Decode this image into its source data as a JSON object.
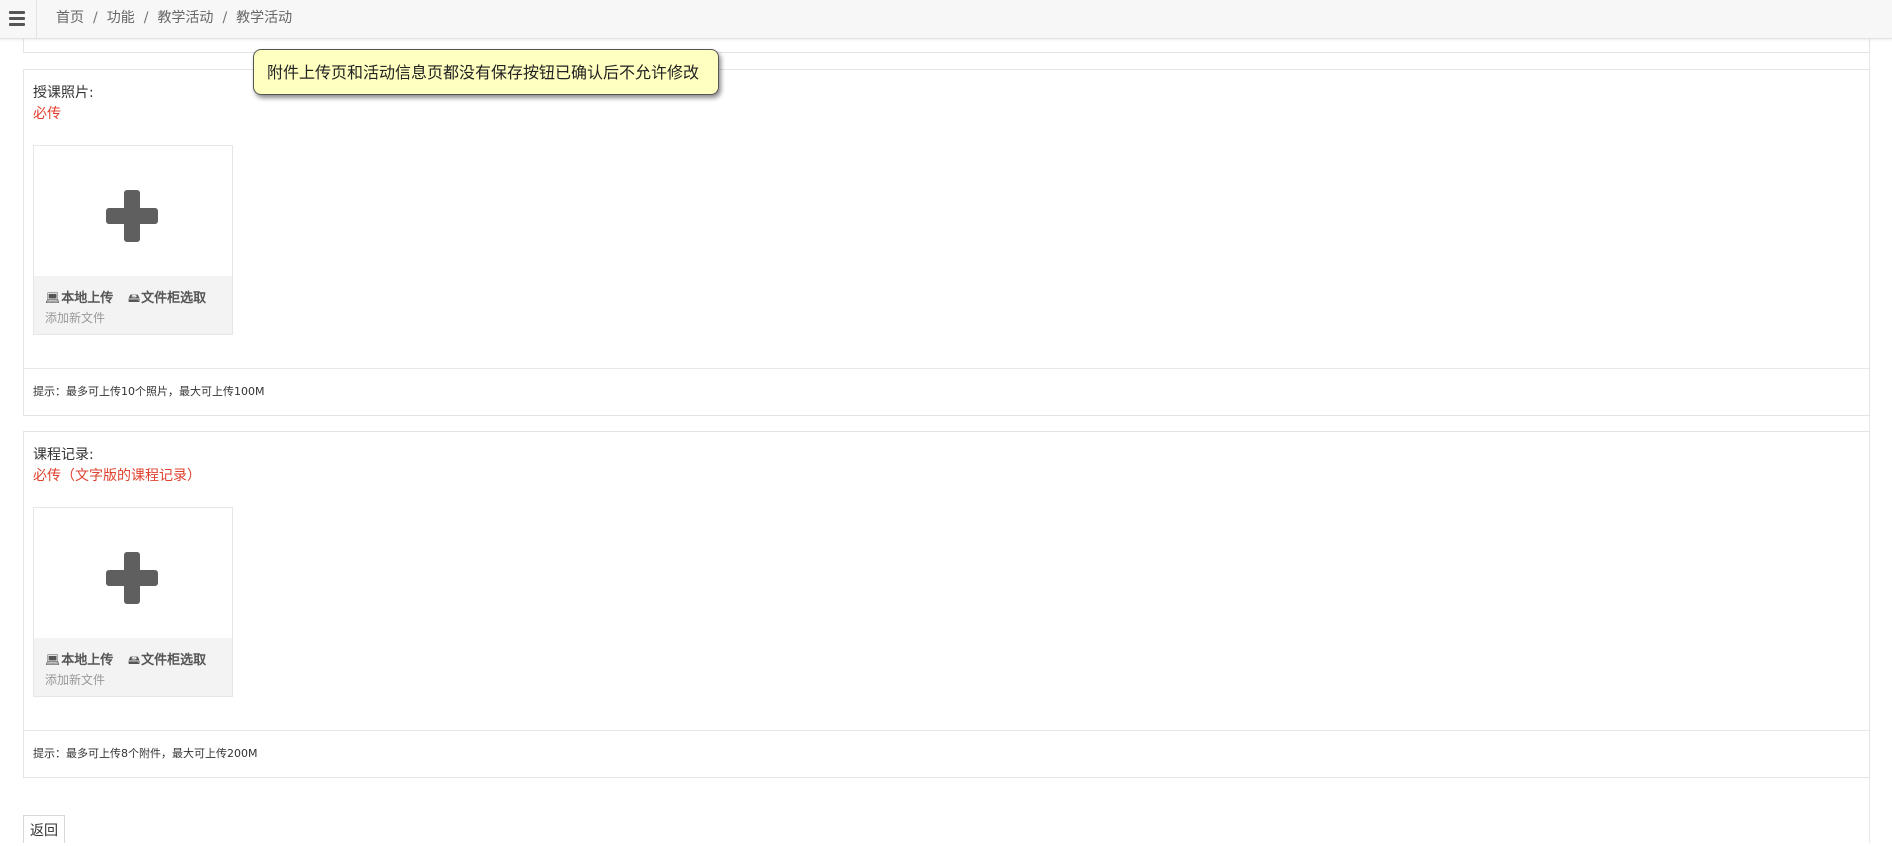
{
  "breadcrumb": [
    "首页",
    "功能",
    "教学活动",
    "教学活动"
  ],
  "breadcrumb_separator": "/",
  "tooltip_text": "附件上传页和活动信息页都没有保存按钮已确认后不允许修改",
  "sections": [
    {
      "title": "授课照片:",
      "required_note": "必传",
      "upload": {
        "local_upload_icon": "laptop-icon",
        "local_upload_label": "本地上传",
        "cabinet_icon": "drive-icon",
        "cabinet_label": "文件柜选取",
        "hint": "添加新文件"
      },
      "tip": "提示：最多可上传10个照片，最大可上传100M"
    },
    {
      "title": "课程记录:",
      "required_note": "必传（文字版的课程记录）",
      "upload": {
        "local_upload_icon": "laptop-icon",
        "local_upload_label": "本地上传",
        "cabinet_icon": "drive-icon",
        "cabinet_label": "文件柜选取",
        "hint": "添加新文件"
      },
      "tip": "提示：最多可上传8个附件，最大可上传200M"
    }
  ],
  "back_label": "返回",
  "colors": {
    "required": "#e0412e",
    "tooltip_bg": "#ffffc0",
    "plus_icon": "#5f5f5f"
  }
}
